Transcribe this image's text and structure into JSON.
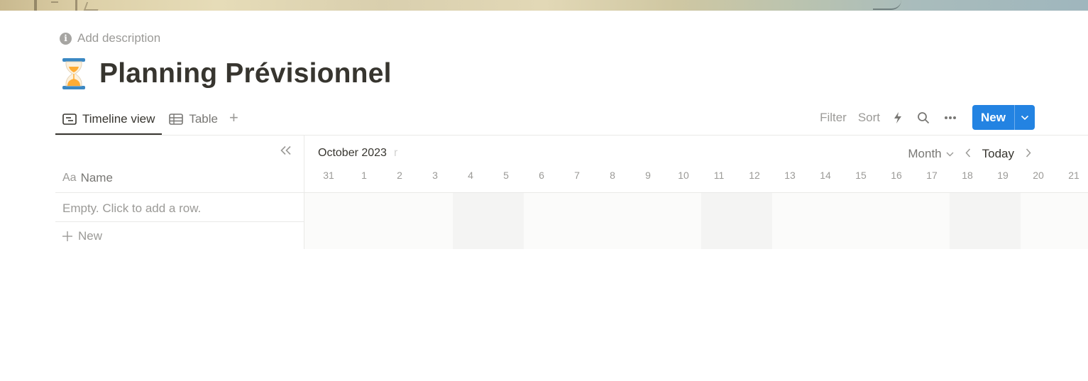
{
  "page": {
    "description_placeholder": "Add description",
    "title": "Planning Prévisionnel",
    "icon": "hourglass-icon"
  },
  "views": {
    "tabs": [
      {
        "label": "Timeline view",
        "icon": "timeline-icon",
        "active": true
      },
      {
        "label": "Table",
        "icon": "table-icon",
        "active": false
      }
    ],
    "add_view_label": "+"
  },
  "toolbar": {
    "filter_label": "Filter",
    "sort_label": "Sort",
    "new_label": "New",
    "icons": [
      "lightning-icon",
      "search-icon",
      "more-icon",
      "chevron-down-icon"
    ],
    "accent_color": "#2383e2"
  },
  "table": {
    "name_header_prefix": "Aa",
    "name_header": "Name",
    "empty_text": "Empty. Click to add a row.",
    "new_row_label": "New"
  },
  "timeline": {
    "month": "October 2023",
    "month_partial": "r",
    "scale": "Month",
    "today_label": "Today",
    "days": [
      "31",
      "1",
      "2",
      "3",
      "4",
      "5",
      "6",
      "7",
      "8",
      "9",
      "10",
      "11",
      "12",
      "13",
      "14",
      "15",
      "16",
      "17",
      "18",
      "19",
      "20",
      "21"
    ]
  }
}
